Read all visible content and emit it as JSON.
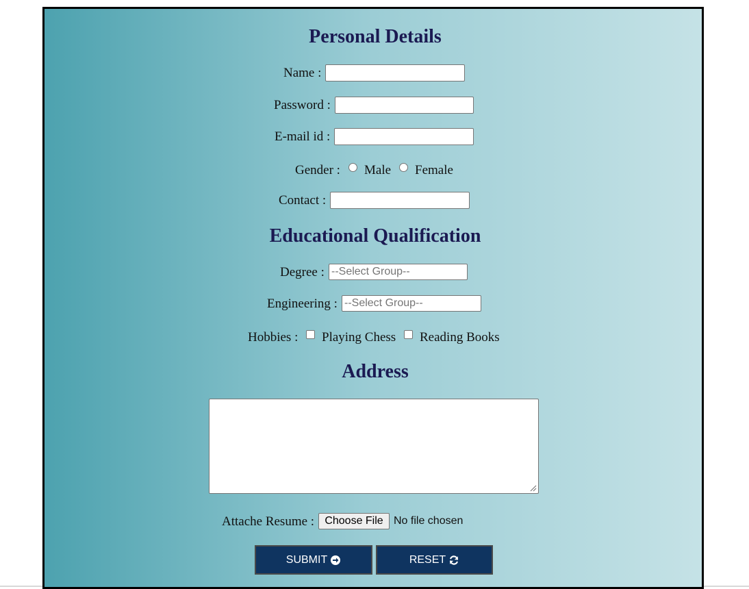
{
  "sections": {
    "personal": "Personal Details",
    "education": "Educational Qualification",
    "address": "Address"
  },
  "fields": {
    "name_label": "Name :",
    "password_label": "Password :",
    "email_label": "E-mail id :",
    "gender_label": "Gender :",
    "gender_male": "Male",
    "gender_female": "Female",
    "contact_label": "Contact :",
    "degree_label": "Degree :",
    "degree_value": "--Select Group--",
    "engineering_label": "Engineering :",
    "engineering_value": "--Select Group--",
    "hobbies_label": "Hobbies :",
    "hobby_chess": "Playing Chess",
    "hobby_books": "Reading Books",
    "resume_label": "Attache Resume :",
    "file_button": "Choose File",
    "file_status": "No file chosen"
  },
  "buttons": {
    "submit": "SUBMIT",
    "reset": "RESET"
  },
  "icons": {
    "submit_icon": "arrow-circle-right-icon",
    "reset_icon": "refresh-icon"
  }
}
